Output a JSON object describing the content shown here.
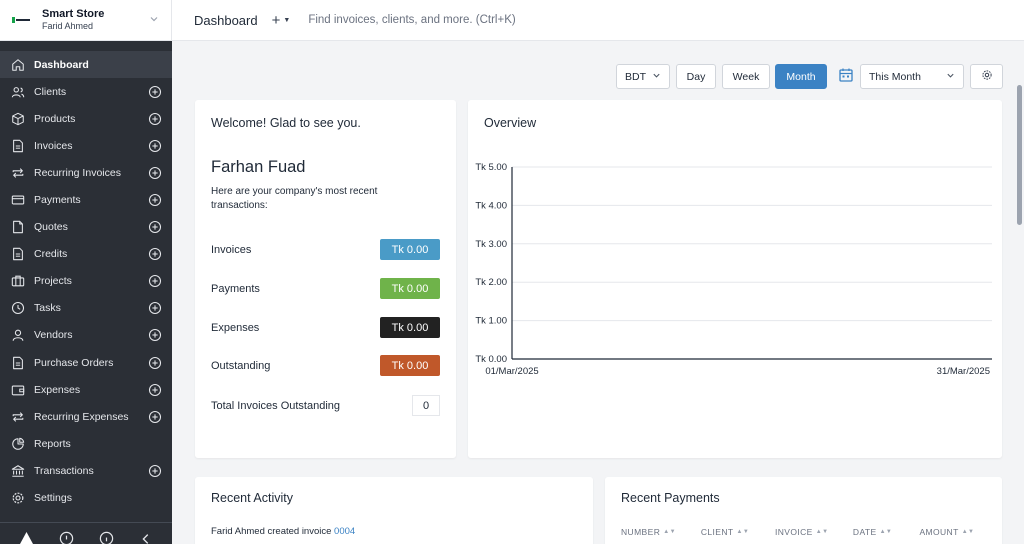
{
  "brand": {
    "name": "Smart Store",
    "user": "Farid Ahmed"
  },
  "topbar": {
    "title": "Dashboard",
    "add": "+",
    "search_placeholder": "Find invoices, clients, and more. (Ctrl+K)"
  },
  "sidebar": {
    "items": [
      {
        "label": "Dashboard",
        "icon": "home-icon",
        "active": true,
        "plus": false
      },
      {
        "label": "Clients",
        "icon": "users-icon",
        "plus": true
      },
      {
        "label": "Products",
        "icon": "box-icon",
        "plus": true
      },
      {
        "label": "Invoices",
        "icon": "file-text-icon",
        "plus": true
      },
      {
        "label": "Recurring Invoices",
        "icon": "repeat-icon",
        "plus": true
      },
      {
        "label": "Payments",
        "icon": "credit-card-icon",
        "plus": true
      },
      {
        "label": "Quotes",
        "icon": "file-icon",
        "plus": true
      },
      {
        "label": "Credits",
        "icon": "file-text-icon",
        "plus": true
      },
      {
        "label": "Projects",
        "icon": "briefcase-icon",
        "plus": true
      },
      {
        "label": "Tasks",
        "icon": "clock-icon",
        "plus": true
      },
      {
        "label": "Vendors",
        "icon": "user-icon",
        "plus": true
      },
      {
        "label": "Purchase Orders",
        "icon": "file-text-icon",
        "plus": true
      },
      {
        "label": "Expenses",
        "icon": "wallet-icon",
        "plus": true
      },
      {
        "label": "Recurring Expenses",
        "icon": "repeat-icon",
        "plus": true
      },
      {
        "label": "Reports",
        "icon": "pie-chart-icon",
        "plus": false
      },
      {
        "label": "Transactions",
        "icon": "bank-icon",
        "plus": true
      },
      {
        "label": "Settings",
        "icon": "gear-icon",
        "plus": false
      }
    ]
  },
  "filters": {
    "currency": "BDT",
    "day": "Day",
    "week": "Week",
    "month": "Month",
    "period": "This Month"
  },
  "welcome": {
    "title": "Welcome! Glad to see you.",
    "name": "Farhan Fuad",
    "description": "Here are your company's most recent transactions:",
    "rows": [
      {
        "label": "Invoices",
        "value": "Tk 0.00",
        "color": "#4a9bc7"
      },
      {
        "label": "Payments",
        "value": "Tk 0.00",
        "color": "#6fb34a"
      },
      {
        "label": "Expenses",
        "value": "Tk 0.00",
        "color": "#222222"
      },
      {
        "label": "Outstanding",
        "value": "Tk 0.00",
        "color": "#c0582a"
      }
    ],
    "total_label": "Total Invoices Outstanding",
    "total_value": "0"
  },
  "overview": {
    "title": "Overview"
  },
  "chart_data": {
    "type": "line",
    "title": "Overview",
    "x": [
      "01/Mar/2025",
      "31/Mar/2025"
    ],
    "series": [],
    "ylim": [
      0,
      5
    ],
    "y_ticks": [
      "Tk 0.00",
      "Tk 1.00",
      "Tk 2.00",
      "Tk 3.00",
      "Tk 4.00",
      "Tk 5.00"
    ],
    "grid": true
  },
  "recent_activity": {
    "title": "Recent Activity",
    "entry_text": "Farid Ahmed created invoice ",
    "entry_link": "0004"
  },
  "recent_payments": {
    "title": "Recent Payments",
    "columns": [
      "NUMBER",
      "CLIENT",
      "INVOICE",
      "DATE",
      "AMOUNT"
    ]
  },
  "colors": {
    "sidebar": "#2b2f36",
    "accent": "#3b82c4"
  }
}
